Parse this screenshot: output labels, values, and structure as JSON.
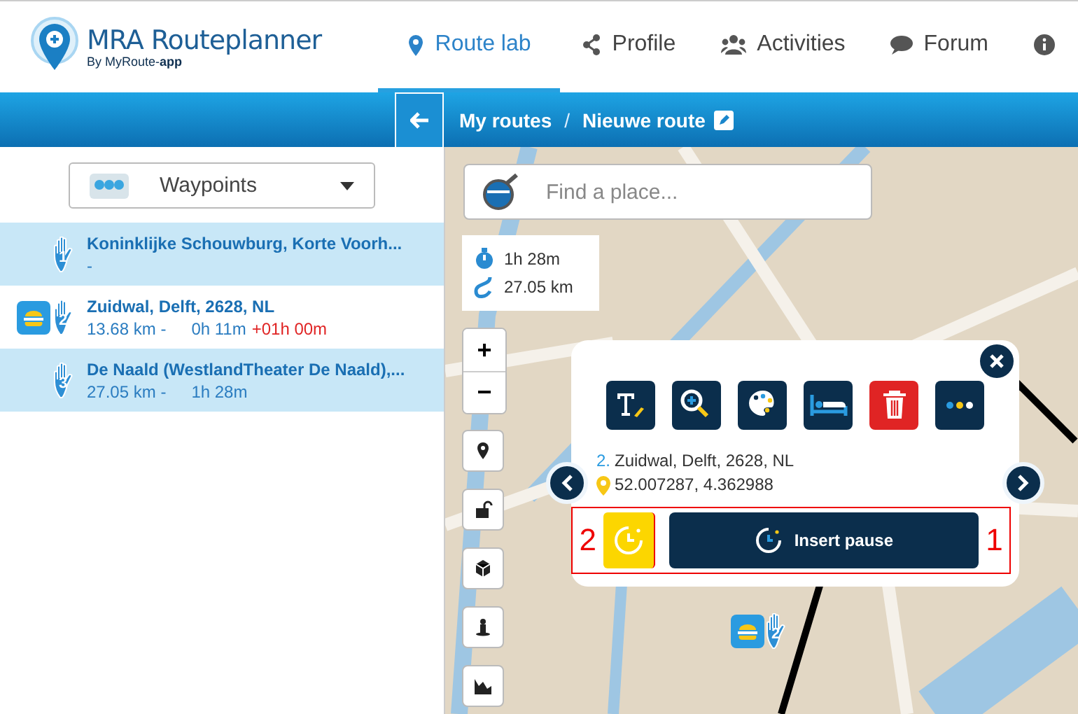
{
  "header": {
    "logo": {
      "title": "MRA Routeplanner",
      "subtitle": "By MyRoute-**app**"
    },
    "nav": [
      {
        "label": "Route lab",
        "kind": "pin",
        "selected": true
      },
      {
        "label": "Profile",
        "kind": "share",
        "selected": false
      },
      {
        "label": "Activities",
        "kind": "users",
        "selected": false
      },
      {
        "label": "Forum",
        "kind": "chat",
        "selected": false
      },
      {
        "kind": "info",
        "selected": false
      }
    ]
  },
  "breadcrumb": {
    "items": [
      "My routes",
      "Nieuwe route"
    ],
    "separator": "/"
  },
  "sidebar": {
    "dropdown": {
      "value": "Waypoints"
    },
    "waypoints": [
      {
        "number": "1",
        "title": "Koninklijke Schouwburg, Korte Voorh...",
        "distance": "-",
        "highlighted": true,
        "pause": false
      },
      {
        "number": "2",
        "title": "Zuidwal, Delft, 2628, NL",
        "distance": "13.68 km -",
        "time": "0h 11m",
        "extra": "+01h 00m",
        "highlighted": false,
        "pause": true
      },
      {
        "number": "3",
        "title": "De Naald (WestlandTheater De Naald),...",
        "distance": "27.05 km -",
        "time": "1h 28m",
        "highlighted": true,
        "pause": false
      }
    ]
  },
  "map": {
    "search": {
      "placeholder": "Find a place..."
    },
    "stats": {
      "duration": "1h 28m",
      "distance": "27.05 km"
    },
    "zoom": [
      "+",
      "−"
    ],
    "tools": [
      {
        "kind": "pin"
      },
      {
        "kind": "lock"
      },
      {
        "kind": "cube"
      },
      {
        "kind": "person"
      },
      {
        "kind": "profile"
      }
    ],
    "popup": {
      "number": "2.",
      "address": "Zuidwal, Delft, 2628, NL",
      "coordinates": "52.007287, 4.362988",
      "actions": [
        {
          "kind": "text"
        },
        {
          "kind": "zoom"
        },
        {
          "kind": "palette"
        },
        {
          "kind": "bed"
        },
        {
          "kind": "delete"
        },
        {
          "kind": "more"
        }
      ],
      "button": "Insert pause",
      "annotations": [
        "2",
        "1"
      ]
    },
    "marker": {
      "number": "2"
    }
  }
}
